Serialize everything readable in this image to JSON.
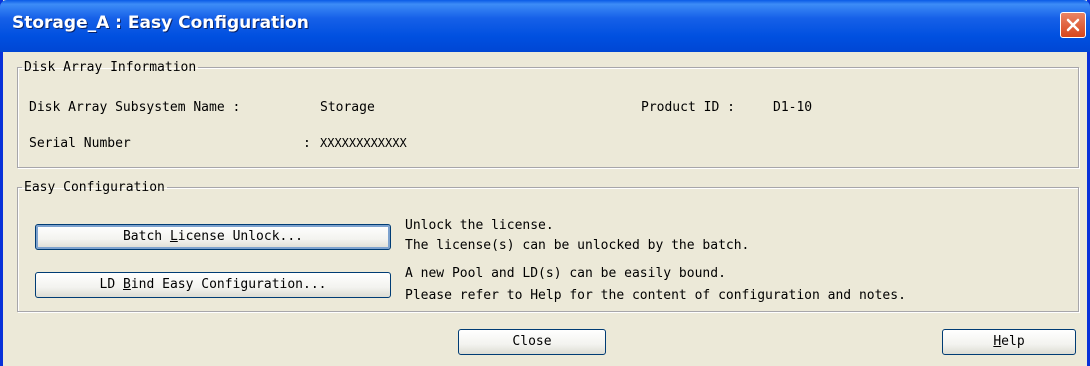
{
  "window": {
    "title": "Storage_A : Easy Configuration"
  },
  "disk_info": {
    "legend": "Disk Array Information",
    "name_label": "Disk Array Subsystem Name : ",
    "name_value": "Storage",
    "product_label": "Product ID : ",
    "product_value": "D1-10",
    "serial_label": "Serial Number",
    "serial_sep": ": ",
    "serial_value": "XXXXXXXXXXXX"
  },
  "easy_config": {
    "legend": "Easy Configuration",
    "batch_button": {
      "pre": "Batch ",
      "mnemonic": "L",
      "post": "icense Unlock..."
    },
    "batch_desc_1": "Unlock the license.",
    "batch_desc_2": "The license(s) can be unlocked by the batch.",
    "ld_button": {
      "pre": "LD ",
      "mnemonic": "B",
      "post": "ind Easy Configuration..."
    },
    "ld_desc_1": "A new Pool and LD(s) can be easily bound.",
    "ld_desc_2": "Please refer to Help for the content of configuration and notes."
  },
  "footer": {
    "close_label": "Close",
    "help_button": {
      "mnemonic": "H",
      "post": "elp"
    }
  }
}
